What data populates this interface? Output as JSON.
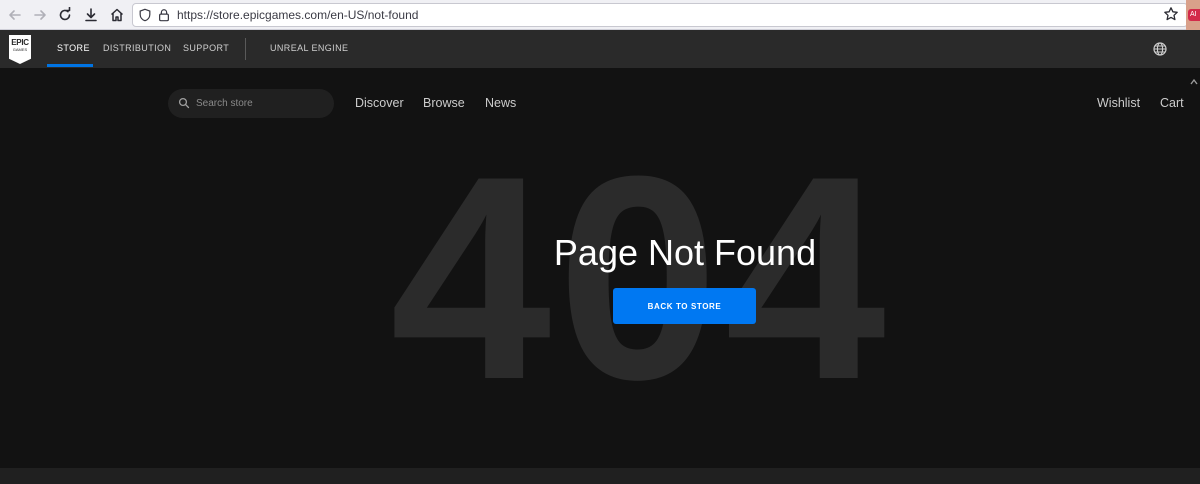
{
  "browser": {
    "url": "https://store.epicgames.com/en-US/not-found",
    "extension_badge": "AI"
  },
  "site_nav": {
    "logo_line1": "EPIC",
    "logo_line2": "GAMES",
    "items": [
      {
        "label": "STORE",
        "active": true
      },
      {
        "label": "DISTRIBUTION"
      },
      {
        "label": "SUPPORT"
      },
      {
        "label": "UNREAL ENGINE"
      }
    ]
  },
  "store_header": {
    "search_placeholder": "Search store",
    "links": [
      "Discover",
      "Browse",
      "News"
    ],
    "right_links": [
      "Wishlist",
      "Cart"
    ]
  },
  "main": {
    "background_code": "404",
    "title": "Page Not Found",
    "button_label": "BACK TO STORE"
  },
  "colors": {
    "accent": "#0078f2",
    "nav_bg": "#2a2a2a",
    "page_bg": "#121212"
  },
  "icons": [
    "back-icon",
    "forward-icon",
    "reload-icon",
    "download-icon",
    "home-icon",
    "shield-icon",
    "lock-icon",
    "star-icon",
    "globe-icon",
    "search-icon"
  ]
}
